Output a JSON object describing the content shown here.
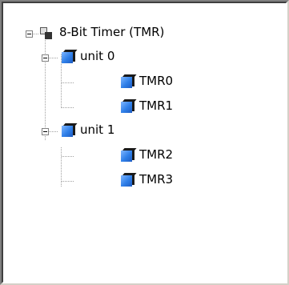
{
  "tree": {
    "root": {
      "label": "8-Bit Timer (TMR)",
      "expanded": true,
      "icon": "module-icon"
    },
    "units": [
      {
        "label": "unit 0",
        "expanded": true,
        "icon": "blue-cube-icon",
        "children": [
          {
            "label": "TMR0",
            "icon": "blue-cube-icon"
          },
          {
            "label": "TMR1",
            "icon": "blue-cube-icon"
          }
        ]
      },
      {
        "label": "unit 1",
        "expanded": true,
        "icon": "blue-cube-icon",
        "children": [
          {
            "label": "TMR2",
            "icon": "blue-cube-icon"
          },
          {
            "label": "TMR3",
            "icon": "blue-cube-icon"
          }
        ]
      }
    ]
  }
}
